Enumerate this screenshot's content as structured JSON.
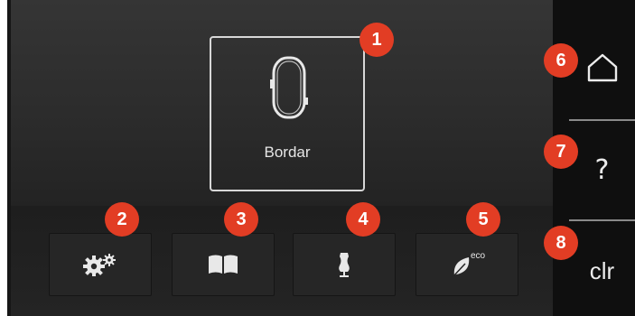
{
  "mode": {
    "label": "Bordar",
    "icon": "embroidery-hoop-icon"
  },
  "toolbar": [
    {
      "icon": "settings-gears-icon"
    },
    {
      "icon": "book-icon"
    },
    {
      "icon": "dress-form-icon"
    },
    {
      "icon": "eco-leaf-icon",
      "eco_text": "eco"
    }
  ],
  "sidebar": {
    "home_icon": "home-icon",
    "help_label": "?",
    "clear_label": "clr"
  },
  "callouts": [
    "1",
    "2",
    "3",
    "4",
    "5",
    "6",
    "7",
    "8"
  ],
  "colors": {
    "callout": "#e23d24",
    "background": "#161616"
  }
}
